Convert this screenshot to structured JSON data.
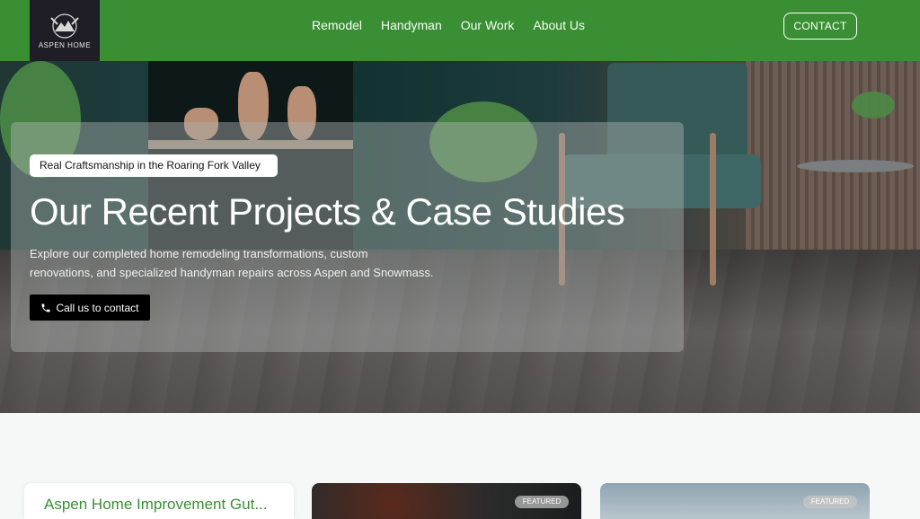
{
  "header": {
    "logo_text": "ASPEN HOME",
    "nav": [
      "Remodel",
      "Handyman",
      "Our Work",
      "About Us"
    ],
    "contact_label": "CONTACT"
  },
  "hero": {
    "tagline": "Real Craftsmanship in the Roaring Fork Valley",
    "title": "Our Recent Projects & Case Studies",
    "description": "Explore our completed home remodeling transformations, custom renovations, and specialized handyman repairs across Aspen and Snowmass.",
    "cta_label": "Call us to contact"
  },
  "cards": [
    {
      "title": "Aspen Home Improvement Gut..."
    },
    {
      "badge": "FEATURED"
    },
    {
      "badge": "FEATURED"
    }
  ],
  "colors": {
    "brand_green": "#3a8f35",
    "logo_bg": "#1f1d25"
  },
  "icons": [
    "logo-mountain-icon",
    "phone-icon"
  ]
}
